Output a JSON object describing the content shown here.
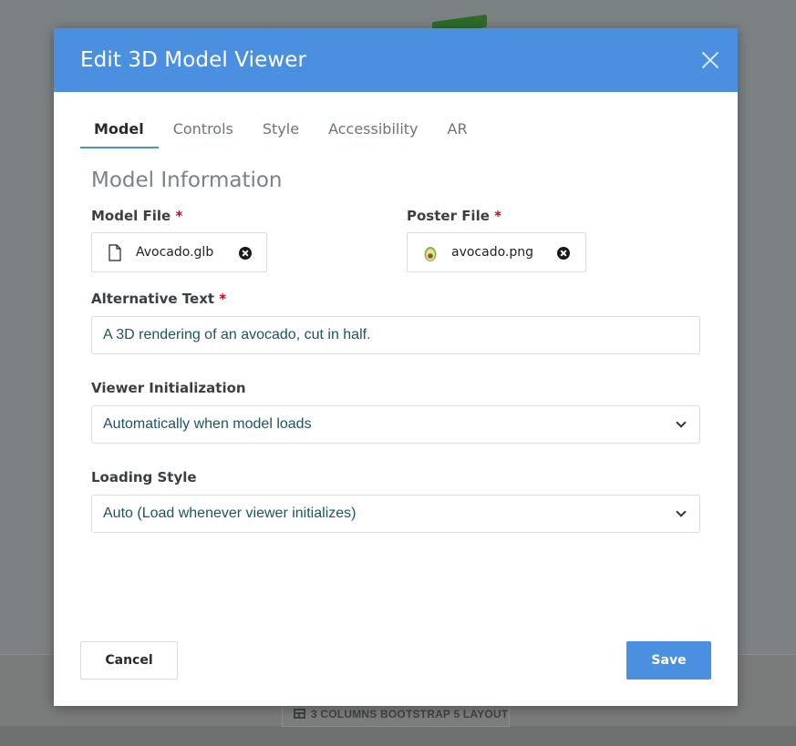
{
  "background": {
    "layout_label": "3 COLUMNS BOOTSTRAP 5 LAYOUT"
  },
  "modal": {
    "title": "Edit 3D Model Viewer",
    "tabs": [
      {
        "label": "Model",
        "active": true
      },
      {
        "label": "Controls",
        "active": false
      },
      {
        "label": "Style",
        "active": false
      },
      {
        "label": "Accessibility",
        "active": false
      },
      {
        "label": "AR",
        "active": false
      }
    ],
    "section_title": "Model Information",
    "model_file": {
      "label": "Model File",
      "required_mark": "*",
      "file_name": "Avocado.glb"
    },
    "poster_file": {
      "label": "Poster File",
      "required_mark": "*",
      "file_name": "avocado.png"
    },
    "alt_text": {
      "label": "Alternative Text",
      "required_mark": "*",
      "value": "A 3D rendering of an avocado, cut in half."
    },
    "viewer_init": {
      "label": "Viewer Initialization",
      "selected": "Automatically when model loads"
    },
    "loading_style": {
      "label": "Loading Style",
      "selected": "Auto (Load whenever viewer initializes)"
    },
    "buttons": {
      "cancel": "Cancel",
      "save": "Save"
    }
  },
  "colors": {
    "accent": "#4a8fe0",
    "required": "#d0021b",
    "input_text": "#1c5561"
  }
}
